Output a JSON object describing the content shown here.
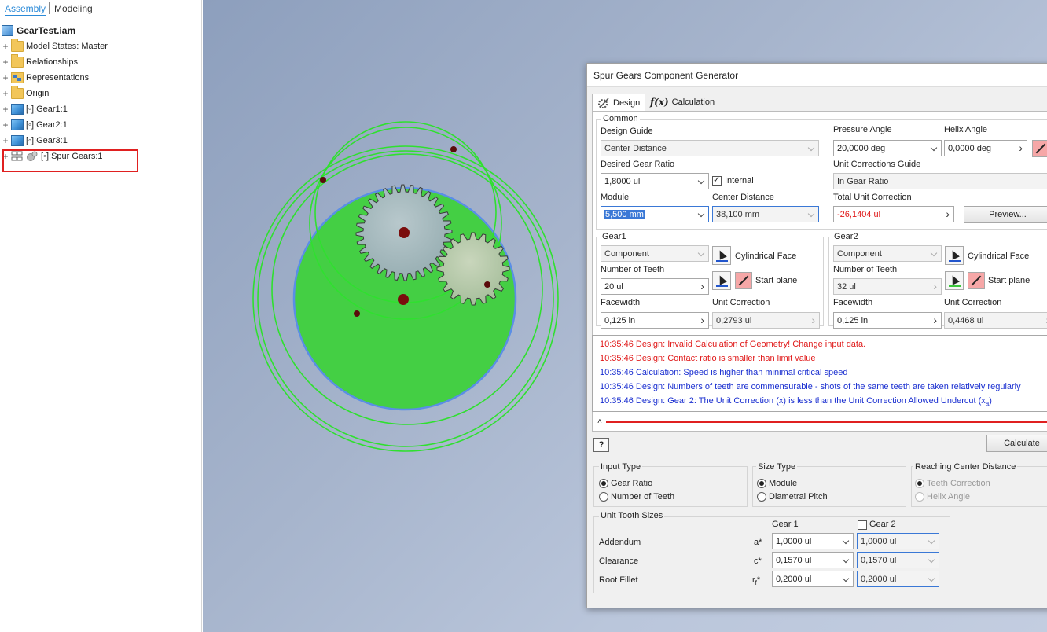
{
  "browser": {
    "tabs": [
      "Assembly",
      "Modeling"
    ],
    "root": "GearTest.iam",
    "items": [
      {
        "label": "Model States: Master",
        "icon": "folder-icon"
      },
      {
        "label": "Relationships",
        "icon": "folder-icon"
      },
      {
        "label": "Representations",
        "icon": "representations-icon"
      },
      {
        "label": "Origin",
        "icon": "folder-icon"
      },
      {
        "label": "[◦]:Gear1:1",
        "icon": "part-icon"
      },
      {
        "label": "[◦]:Gear2:1",
        "icon": "part-icon"
      },
      {
        "label": "[◦]:Gear3:1",
        "icon": "part-icon"
      },
      {
        "label": "[◦]:Spur Gears:1",
        "icon": "spur-gears-icon"
      }
    ]
  },
  "dialog": {
    "title": "Spur Gears Component Generator",
    "tabs": {
      "design": "Design",
      "calculation": "Calculation"
    },
    "common": {
      "group": "Common",
      "design_guide_label": "Design Guide",
      "design_guide_value": "Center Distance",
      "pressure_angle_label": "Pressure Angle",
      "pressure_angle_value": "20,0000 deg",
      "helix_angle_label": "Helix Angle",
      "helix_angle_value": "0,0000 deg",
      "desired_ratio_label": "Desired Gear Ratio",
      "desired_ratio_value": "1,8000 ul",
      "internal_label": "Internal",
      "unit_corr_guide_label": "Unit Corrections Guide",
      "unit_corr_guide_value": "In Gear Ratio",
      "module_label": "Module",
      "module_value": "5,500 mm",
      "center_distance_label": "Center Distance",
      "center_distance_value": "38,100 mm",
      "total_unit_corr_label": "Total Unit Correction",
      "total_unit_corr_value": "-26,1404 ul",
      "preview_button": "Preview..."
    },
    "gear1": {
      "group": "Gear1",
      "type_value": "Component",
      "cyl_face_label": "Cylindrical Face",
      "teeth_label": "Number of Teeth",
      "teeth_value": "20 ul",
      "start_plane_label": "Start plane",
      "facewidth_label": "Facewidth",
      "facewidth_value": "0,125 in",
      "unit_corr_label": "Unit Correction",
      "unit_corr_value": "0,2793 ul"
    },
    "gear2": {
      "group": "Gear2",
      "type_value": "Component",
      "cyl_face_label": "Cylindrical Face",
      "teeth_label": "Number of Teeth",
      "teeth_value": "32 ul",
      "start_plane_label": "Start plane",
      "facewidth_label": "Facewidth",
      "facewidth_value": "0,125 in",
      "unit_corr_label": "Unit Correction",
      "unit_corr_value": "0,4468 ul"
    },
    "messages": [
      {
        "text": "10:35:46 Design: Invalid Calculation of Geometry! Change input data.",
        "kind": "err"
      },
      {
        "text": "10:35:46 Design: Contact ratio is smaller than limit value",
        "kind": "err"
      },
      {
        "text": "10:35:46 Calculation: Speed is higher than minimal critical speed",
        "kind": "info"
      },
      {
        "text": "10:35:46 Design: Numbers of teeth are commensurable - shots of the same teeth are taken relatively regularly",
        "kind": "info"
      },
      {
        "text": "10:35:46 Design: Gear 2: The Unit Correction (x) is less than the Unit Correction Allowed Undercut (x",
        "sub": "a",
        "tail": ")",
        "kind": "info"
      }
    ],
    "help_button": "?",
    "calculate_button": "Calculate",
    "input_type": {
      "group": "Input Type",
      "options": [
        "Gear Ratio",
        "Number of Teeth"
      ],
      "selected": "Gear Ratio"
    },
    "size_type": {
      "group": "Size Type",
      "options": [
        "Module",
        "Diametral Pitch"
      ],
      "selected": "Module"
    },
    "reaching": {
      "group": "Reaching Center Distance",
      "options": [
        "Teeth Correction",
        "Helix Angle"
      ],
      "selected": "Teeth Correction"
    },
    "unit_tooth": {
      "group": "Unit Tooth Sizes",
      "gear1_header": "Gear 1",
      "gear2_header": "Gear 2",
      "rows": [
        {
          "label": "Addendum",
          "symbol": "a*",
          "g1": "1,0000 ul",
          "g2": "1,0000 ul"
        },
        {
          "label": "Clearance",
          "symbol": "c*",
          "g1": "0,1570 ul",
          "g2": "0,1570 ul"
        },
        {
          "label": "Root Fillet",
          "symbol": "r",
          "symbol_sub": "f",
          "symbol_tail": "*",
          "g1": "0,2000 ul",
          "g2": "0,2000 ul"
        }
      ]
    }
  }
}
